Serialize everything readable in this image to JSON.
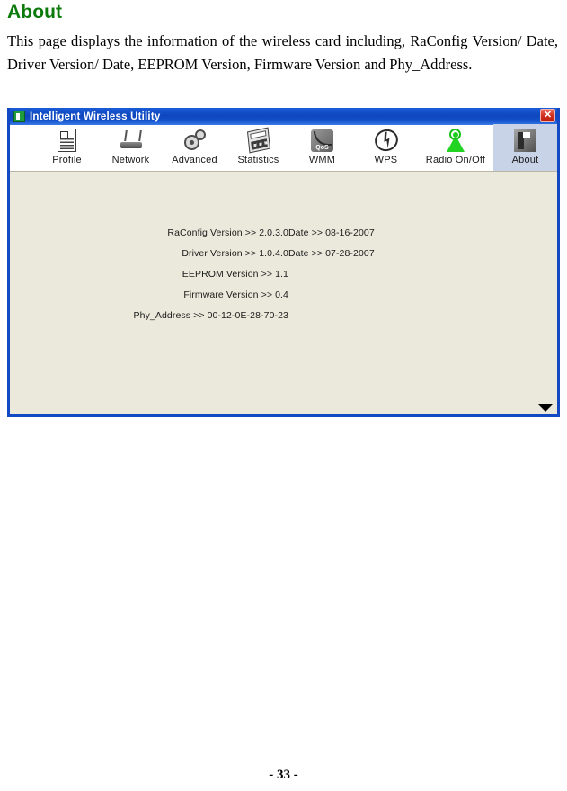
{
  "document": {
    "heading": "About",
    "paragraph": "This page displays the information of the wireless card including, RaConfig Version/ Date, Driver Version/ Date, EEPROM Version, Firmware Version and Phy_Address.",
    "page_number": "- 33 -"
  },
  "window": {
    "title": "Intelligent Wireless Utility",
    "close_label": "✕",
    "titlebar_color": "#0e46bd",
    "border_color": "#1449c4",
    "content_color": "#ebe9db",
    "selected_tab_color": "#c9d3e8"
  },
  "toolbar": {
    "items": [
      {
        "label": "Profile",
        "icon": "profile-icon",
        "selected": false
      },
      {
        "label": "Network",
        "icon": "network-icon",
        "selected": false
      },
      {
        "label": "Advanced",
        "icon": "advanced-icon",
        "selected": false
      },
      {
        "label": "Statistics",
        "icon": "statistics-icon",
        "selected": false
      },
      {
        "label": "WMM",
        "icon": "wmm-qos-icon",
        "selected": false
      },
      {
        "label": "WPS",
        "icon": "wps-icon",
        "selected": false
      },
      {
        "label": "Radio On/Off",
        "icon": "radio-onoff-icon",
        "selected": false
      },
      {
        "label": "About",
        "icon": "about-icon",
        "selected": true
      }
    ]
  },
  "about_panel": {
    "separator": ">>",
    "rows": [
      {
        "label": "RaConfig Version",
        "value": "2.0.3.0",
        "date_label": "Date",
        "date_value": "08-16-2007"
      },
      {
        "label": "Driver Version",
        "value": "1.0.4.0",
        "date_label": "Date",
        "date_value": "07-28-2007"
      },
      {
        "label": "EEPROM Version",
        "value": "1.1",
        "date_label": "",
        "date_value": ""
      },
      {
        "label": "Firmware Version",
        "value": "0.4",
        "date_label": "",
        "date_value": ""
      },
      {
        "label": "Phy_Address",
        "value": "00-12-0E-28-70-23",
        "date_label": "",
        "date_value": ""
      }
    ],
    "scroll_arrow": "▼"
  }
}
